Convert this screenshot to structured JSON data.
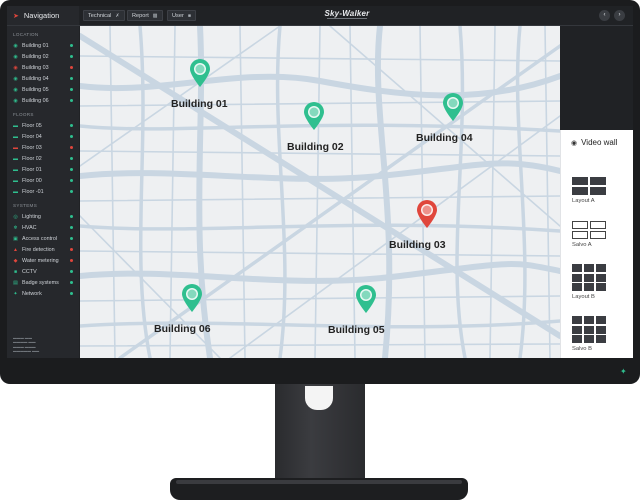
{
  "sidebar": {
    "title": "Navigation",
    "sections": [
      {
        "title": "LOCATION",
        "items": [
          {
            "label": "Building 01",
            "icon": "map-pin-icon",
            "status": "ok"
          },
          {
            "label": "Building 02",
            "icon": "map-pin-icon",
            "status": "ok"
          },
          {
            "label": "Building 03",
            "icon": "map-pin-icon",
            "status": "alert"
          },
          {
            "label": "Building 04",
            "icon": "map-pin-icon",
            "status": "ok"
          },
          {
            "label": "Building 05",
            "icon": "map-pin-icon",
            "status": "ok"
          },
          {
            "label": "Building 06",
            "icon": "map-pin-icon",
            "status": "ok"
          }
        ]
      },
      {
        "title": "FLOORS",
        "items": [
          {
            "label": "Floor 05",
            "icon": "floor-icon",
            "status": "ok"
          },
          {
            "label": "Floor 04",
            "icon": "floor-icon",
            "status": "ok"
          },
          {
            "label": "Floor 03",
            "icon": "floor-icon",
            "status": "alert"
          },
          {
            "label": "Floor 02",
            "icon": "floor-icon",
            "status": "ok"
          },
          {
            "label": "Floor 01",
            "icon": "floor-icon",
            "status": "ok"
          },
          {
            "label": "Floor 00",
            "icon": "floor-icon",
            "status": "ok"
          },
          {
            "label": "Floor -01",
            "icon": "floor-icon",
            "status": "ok"
          }
        ]
      },
      {
        "title": "SYSTEMS",
        "items": [
          {
            "label": "Lighting",
            "icon": "bulb-icon",
            "status": "ok"
          },
          {
            "label": "HVAC",
            "icon": "hvac-icon",
            "status": "ok"
          },
          {
            "label": "Access control",
            "icon": "lock-icon",
            "status": "ok"
          },
          {
            "label": "Fire detection",
            "icon": "flame-icon",
            "status": "alert"
          },
          {
            "label": "Water metering",
            "icon": "drop-icon",
            "status": "alert"
          },
          {
            "label": "CCTV",
            "icon": "camera-icon",
            "status": "ok"
          },
          {
            "label": "Badge systems",
            "icon": "badge-icon",
            "status": "ok"
          },
          {
            "label": "Network",
            "icon": "network-icon",
            "status": "ok"
          }
        ]
      }
    ]
  },
  "topbar": {
    "tabs": [
      {
        "label": "Technical",
        "icon": "wrench-icon"
      },
      {
        "label": "Report",
        "icon": "bar-chart-icon"
      },
      {
        "label": "User",
        "icon": "user-icon"
      }
    ],
    "brand": "Sky-Walker",
    "prev_icon": "chevron-left-icon",
    "next_icon": "chevron-right-icon"
  },
  "map": {
    "buildings": [
      {
        "label": "Building 01",
        "status": "ok"
      },
      {
        "label": "Building 02",
        "status": "ok"
      },
      {
        "label": "Building 04",
        "status": "ok"
      },
      {
        "label": "Building 03",
        "status": "alert"
      },
      {
        "label": "Building 06",
        "status": "ok"
      },
      {
        "label": "Building 05",
        "status": "ok"
      }
    ]
  },
  "video_wall": {
    "title": "Video wall",
    "icon": "eye-icon",
    "layouts": [
      {
        "label": "Layout A",
        "cols": 2,
        "rows": 2,
        "style": "filled"
      },
      {
        "label": "Salvo A",
        "cols": 2,
        "rows": 2,
        "style": "outline"
      },
      {
        "label": "Layout B",
        "cols": 3,
        "rows": 3,
        "style": "filled"
      },
      {
        "label": "Salvo B",
        "cols": 3,
        "rows": 3,
        "style": "filled"
      }
    ]
  },
  "colors": {
    "ok": "#2fbf8f",
    "alert": "#e0463c",
    "map_road": "#c9d6e2",
    "map_bg": "#eef0f2"
  }
}
